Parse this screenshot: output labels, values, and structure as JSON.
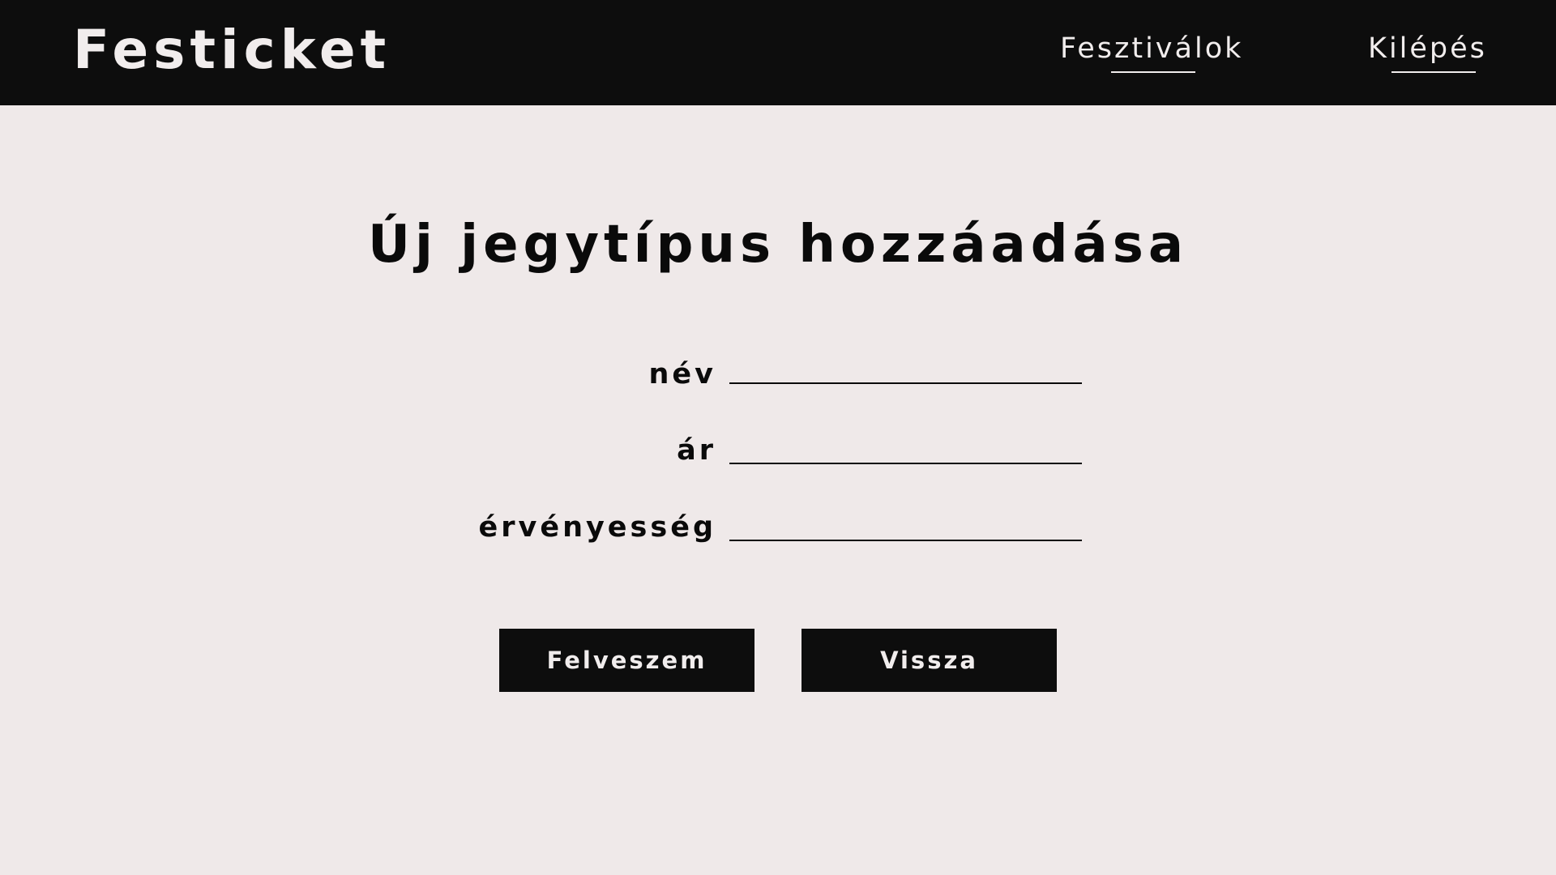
{
  "header": {
    "brand": "Festicket",
    "nav": {
      "festivals": "Fesztiválok",
      "logout": "Kilépés"
    }
  },
  "main": {
    "title": "Új jegytípus hozzáadása",
    "form": {
      "name_label": "név",
      "name_value": "",
      "price_label": "ár",
      "price_value": "",
      "validity_label": "érvényesség",
      "validity_value": ""
    },
    "buttons": {
      "submit_label": "Felveszem",
      "back_label": "Vissza"
    }
  },
  "colors": {
    "header_bg": "#0d0d0d",
    "page_bg": "#efe9e9",
    "text_light": "#f1eded",
    "text_dark": "#0a0a0a"
  }
}
